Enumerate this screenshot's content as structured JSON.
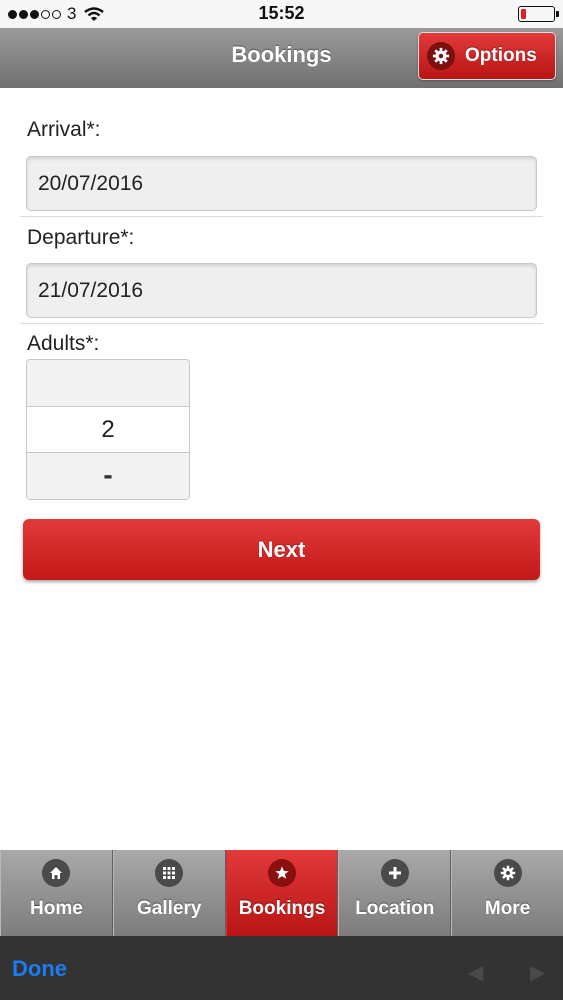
{
  "status_bar": {
    "carrier": "3",
    "time": "15:52",
    "battery_level": 0.15,
    "battery_color": "#e02020"
  },
  "header": {
    "title": "Bookings",
    "options_label": "Options",
    "options_icon": "gear-icon"
  },
  "form": {
    "arrival_label": "Arrival*:",
    "arrival_value": "20/07/2016",
    "departure_label": "Departure*:",
    "departure_value": "21/07/2016",
    "adults_label": "Adults*:",
    "adults_value": "2",
    "decrement_label": "-",
    "next_label": "Next"
  },
  "tabs": [
    {
      "label": "Home",
      "icon": "home-icon",
      "active": false
    },
    {
      "label": "Gallery",
      "icon": "grid-icon",
      "active": false
    },
    {
      "label": "Bookings",
      "icon": "star-icon",
      "active": true
    },
    {
      "label": "Location",
      "icon": "plus-icon",
      "active": false
    },
    {
      "label": "More",
      "icon": "gear-icon",
      "active": false
    }
  ],
  "accessory": {
    "done_label": "Done"
  },
  "colors": {
    "accent_red": "#d12626",
    "header_gray": "#808080",
    "done_blue": "#1b7df2"
  }
}
